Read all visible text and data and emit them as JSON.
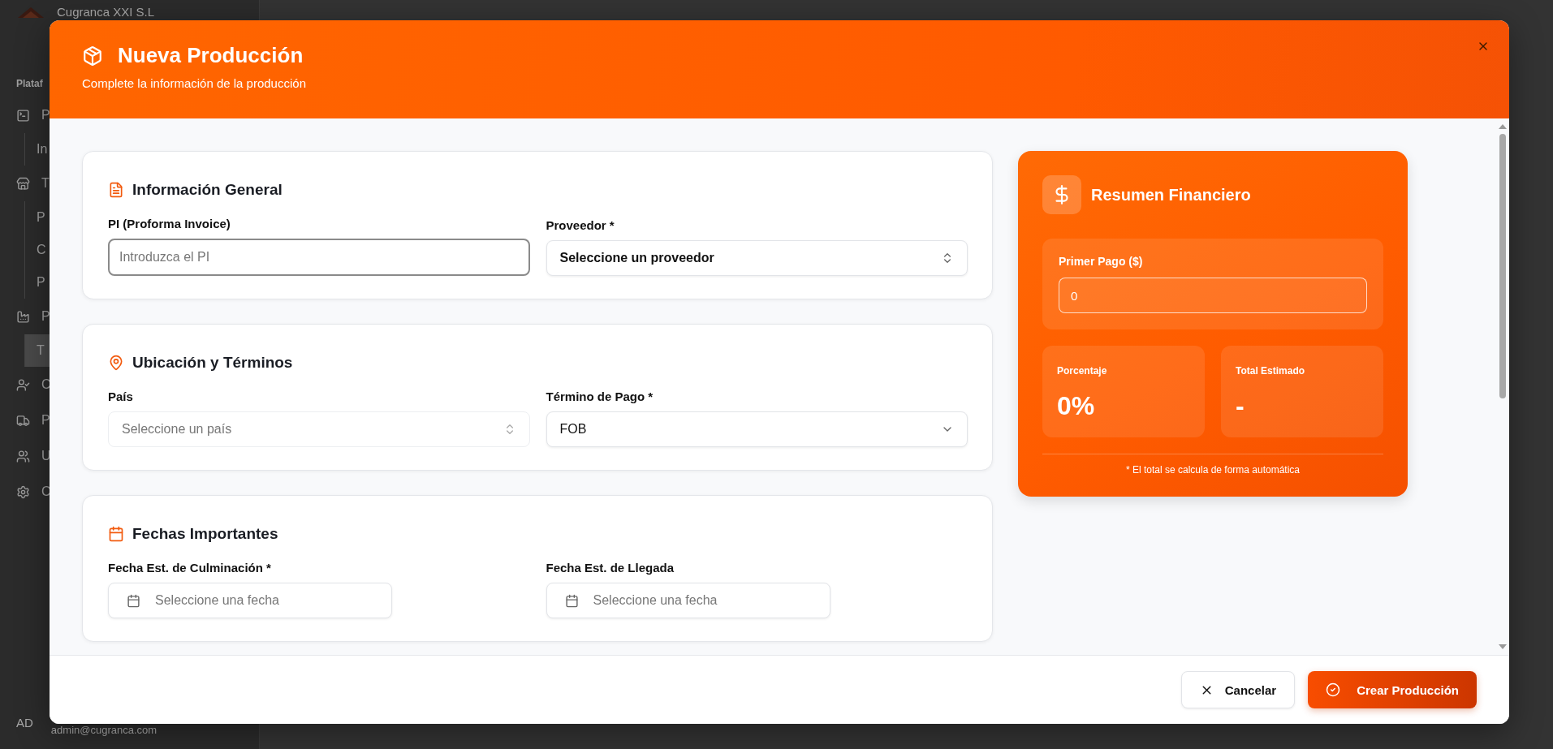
{
  "background": {
    "company": "Cugranca XXI S.L",
    "section": "Plataf",
    "nav": [
      {
        "label": "P",
        "selected": false,
        "children": [
          {
            "label": "In",
            "selected": false
          }
        ]
      },
      {
        "label": "T",
        "selected": false,
        "children": [
          {
            "label": "P",
            "selected": false
          },
          {
            "label": "C",
            "selected": false
          },
          {
            "label": "P",
            "selected": false
          }
        ]
      },
      {
        "label": "P",
        "selected": false,
        "children": [
          {
            "label": "T",
            "selected": true
          }
        ]
      },
      {
        "label": "C",
        "selected": false
      },
      {
        "label": "P",
        "selected": false
      },
      {
        "label": "U",
        "selected": false
      },
      {
        "label": "C",
        "selected": false
      }
    ],
    "user": {
      "initials": "AD",
      "email": "admin@cugranca.com"
    }
  },
  "modal": {
    "title": "Nueva Producción",
    "subtitle": "Complete la información de la producción",
    "sections": [
      {
        "title": "Información General",
        "fields": [
          {
            "kind": "input",
            "label": "PI (Proforma Invoice)",
            "placeholder": "Introduzca el PI",
            "focused": true
          },
          {
            "kind": "select",
            "label": "Proveedor *",
            "value": "Seleccione un proveedor",
            "disabled": false
          }
        ]
      },
      {
        "title": "Ubicación y Términos",
        "fields": [
          {
            "kind": "select",
            "label": "País",
            "placeholder": "Seleccione un país",
            "disabled": true
          },
          {
            "kind": "dropdown",
            "label": "Término de Pago *",
            "value": "FOB",
            "disabled": false
          }
        ]
      },
      {
        "title": "Fechas Importantes",
        "fields": [
          {
            "kind": "date",
            "label": "Fecha Est. de Culminación *",
            "placeholder": "Seleccione una fecha"
          },
          {
            "kind": "date",
            "label": "Fecha Est. de Llegada",
            "placeholder": "Seleccione una fecha"
          }
        ]
      }
    ],
    "summary": {
      "title": "Resumen Financiero",
      "first_payment": {
        "label": "Primer Pago ($)",
        "value": "0"
      },
      "stats": [
        {
          "label": "Porcentaje",
          "value": "0%"
        },
        {
          "label": "Total Estimado",
          "value": "-"
        }
      ],
      "note": "* El total se calcula de forma automática"
    },
    "buttons": [
      {
        "kind": "secondary",
        "label": "Cancelar"
      },
      {
        "kind": "primary",
        "label": "Crear Producción"
      }
    ]
  }
}
